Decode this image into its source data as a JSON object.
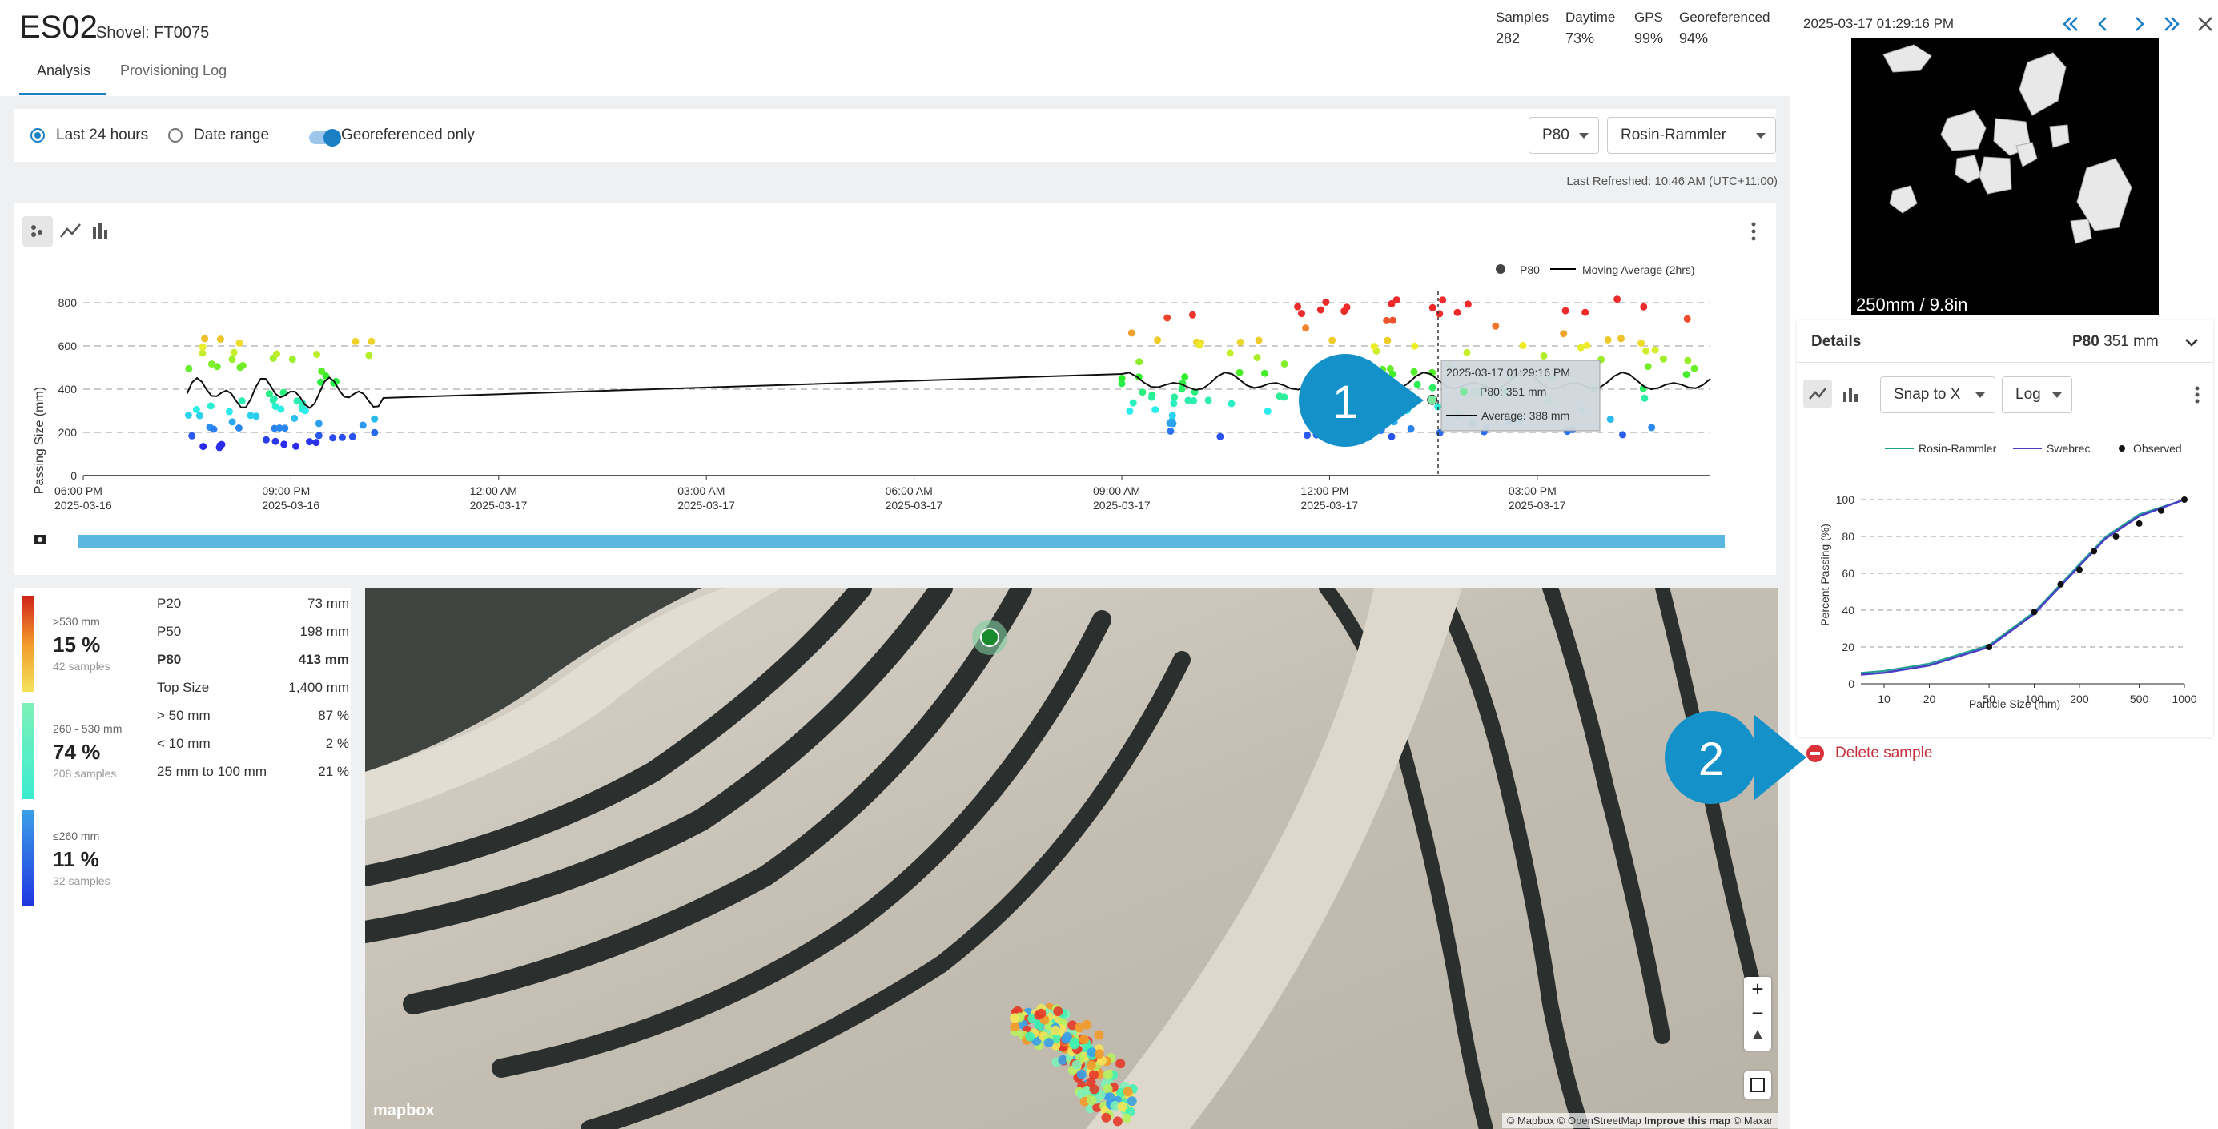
{
  "header": {
    "title": "ES02",
    "subtitle": "Shovel: FT0075",
    "tabs": [
      {
        "label": "Analysis"
      },
      {
        "label": "Provisioning Log"
      }
    ],
    "stats": [
      {
        "label": "Samples",
        "value": "282"
      },
      {
        "label": "Daytime",
        "value": "73%"
      },
      {
        "label": "GPS",
        "value": "99%"
      },
      {
        "label": "Georeferenced",
        "value": "94%"
      }
    ]
  },
  "filters": {
    "last24": "Last 24 hours",
    "date_range": "Date range",
    "georef_only": "Georeferenced only",
    "metric": "P80",
    "model": "Rosin-Rammler",
    "last_refreshed": "Last Refreshed: 10:46 AM (UTC+11:00)"
  },
  "timeline": {
    "legend_p80": "P80",
    "legend_ma": "Moving Average (2hrs)",
    "tooltip": {
      "time": "2025-03-17  01:29:16 PM",
      "p80": "P80:  351 mm",
      "avg": "Average:  388 mm"
    }
  },
  "chart_data": [
    {
      "type": "scatter",
      "ylabel": "Passing Size (mm)",
      "ylim": [
        0,
        800
      ],
      "yticks": [
        "0",
        "200",
        "400",
        "600",
        "800"
      ],
      "xticks": [
        {
          "time": "06:00 PM",
          "date": "2025-03-16"
        },
        {
          "time": "09:00 PM",
          "date": "2025-03-16"
        },
        {
          "time": "12:00 AM",
          "date": "2025-03-17"
        },
        {
          "time": "03:00 AM",
          "date": "2025-03-17"
        },
        {
          "time": "06:00 AM",
          "date": "2025-03-17"
        },
        {
          "time": "09:00 AM",
          "date": "2025-03-17"
        },
        {
          "time": "12:00 PM",
          "date": "2025-03-17"
        },
        {
          "time": "03:00 PM",
          "date": "2025-03-17"
        }
      ],
      "x_start": "2025-03-16 06:00 PM",
      "x_end": "2025-03-17 05:30 PM",
      "series": [
        {
          "name": "P80",
          "color_scale": "by value (blue → red)"
        },
        {
          "name": "Moving Average (2hrs)",
          "color": "#000000"
        }
      ],
      "clusters": [
        {
          "from": "2025-03-16 07:30 PM",
          "to": "2025-03-16 10:20 PM",
          "p80_range": [
            130,
            640
          ],
          "ma_range": [
            300,
            530
          ]
        },
        {
          "from": "2025-03-17 09:00 AM",
          "to": "2025-03-17 05:30 PM",
          "p80_range": [
            180,
            820
          ],
          "ma_range": [
            380,
            520
          ]
        }
      ],
      "selected": {
        "time": "2025-03-17 01:29:16 PM",
        "p80": 351,
        "average": 388
      }
    },
    {
      "type": "line",
      "title": "",
      "xlabel": "Particle Size (mm)",
      "ylabel": "Percent Passing (%)",
      "x_scale": "log",
      "xticks": [
        "10",
        "20",
        "50",
        "100",
        "200",
        "500",
        "1000"
      ],
      "yticks": [
        "0",
        "20",
        "40",
        "60",
        "80",
        "100"
      ],
      "ylim": [
        0,
        100
      ],
      "series": [
        {
          "name": "Rosin-Rammler",
          "color": "#20a090"
        },
        {
          "name": "Swebrec",
          "color": "#4a3fc4"
        },
        {
          "name": "Observed",
          "color": "#111111"
        }
      ],
      "observed": [
        {
          "x": 50,
          "y": 20
        },
        {
          "x": 100,
          "y": 39
        },
        {
          "x": 150,
          "y": 54
        },
        {
          "x": 200,
          "y": 62
        },
        {
          "x": 250,
          "y": 72
        },
        {
          "x": 350,
          "y": 80
        },
        {
          "x": 500,
          "y": 87
        },
        {
          "x": 700,
          "y": 94
        },
        {
          "x": 1000,
          "y": 100
        }
      ],
      "fit": [
        {
          "x": 7,
          "y": 5
        },
        {
          "x": 10,
          "y": 6
        },
        {
          "x": 20,
          "y": 10
        },
        {
          "x": 50,
          "y": 20
        },
        {
          "x": 100,
          "y": 38
        },
        {
          "x": 200,
          "y": 64
        },
        {
          "x": 300,
          "y": 79
        },
        {
          "x": 500,
          "y": 91
        },
        {
          "x": 1000,
          "y": 100
        }
      ]
    }
  ],
  "bins": [
    {
      "range": ">530 mm",
      "pct": "15 %",
      "samples": "42 samples",
      "color": "#e63a2a"
    },
    {
      "range": "260 - 530 mm",
      "pct": "74 %",
      "samples": "208 samples",
      "color": "#3ff2b3"
    },
    {
      "range": "≤260 mm",
      "pct": "11 %",
      "samples": "32 samples",
      "color": "#2f6ae8"
    }
  ],
  "summary": [
    {
      "label": "P20",
      "value": "73 mm"
    },
    {
      "label": "P50",
      "value": "198 mm"
    },
    {
      "label": "P80",
      "value": "413 mm"
    },
    {
      "label": "Top Size",
      "value": "1,400 mm"
    },
    {
      "label": "> 50 mm",
      "value": "87 %"
    },
    {
      "label": "< 10 mm",
      "value": "2 %"
    },
    {
      "label": "25 mm to 100 mm",
      "value": "21 %"
    }
  ],
  "map": {
    "zoom_in": "+",
    "zoom_out": "−",
    "logo": "mapbox",
    "attribution": "© Mapbox © OpenStreetMap",
    "improve": "Improve this map",
    "maxar": "© Maxar"
  },
  "sample": {
    "timestamp": "2025-03-17 01:29:16 PM",
    "scale": "250mm / 9.8in",
    "details_title": "Details",
    "p80_label": "P80",
    "p80_value": "351 mm",
    "snap": "Snap to X",
    "scale_mode": "Log",
    "legend_rr": "Rosin-Rammler",
    "legend_sw": "Swebrec",
    "legend_obs": "Observed",
    "delete": "Delete sample"
  },
  "callouts": {
    "one": "1",
    "two": "2"
  },
  "icons": {
    "first": "double-chevron-left-icon",
    "prev": "chevron-left-icon",
    "next": "chevron-right-icon",
    "last": "double-chevron-right-icon",
    "close": "close-icon"
  }
}
